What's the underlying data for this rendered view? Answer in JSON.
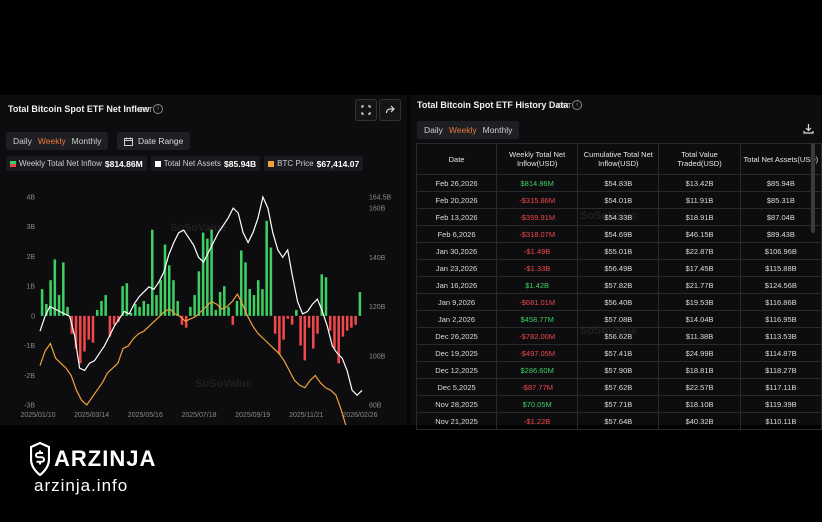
{
  "left_panel": {
    "title": "Total Bitcoin Spot ETF Net Inflow",
    "timezone": "EST",
    "tabs": [
      "Daily",
      "Weekly",
      "Monthly"
    ],
    "active_tab": "Weekly",
    "date_range_label": "Date Range",
    "legend": [
      {
        "label": "Weekly Total Net Inflow",
        "value": "$814.86M",
        "color": "#3ecf63"
      },
      {
        "label": "Total Net Assets",
        "value": "$85.94B",
        "color": "#ffffff"
      },
      {
        "label": "BTC Price",
        "value": "$67,414.07",
        "color": "#f0a33a"
      }
    ],
    "watermark": "SoSoValue"
  },
  "chart_data": {
    "type": "bar",
    "title": "Total Bitcoin Spot ETF Net Inflow",
    "x_ticks": [
      "2025/01/10",
      "2025/03/14",
      "2025/05/16",
      "2025/07/18",
      "2025/09/19",
      "2025/11/21",
      "2026/02/26"
    ],
    "y_left_ticks": [
      "4B",
      "3B",
      "2B",
      "1B",
      "0",
      "-1B",
      "-2B",
      "-3B"
    ],
    "y_left_range": [
      -3,
      4
    ],
    "y_right_ticks": [
      "164.5B",
      "160B",
      "140B",
      "120B",
      "100B",
      "80B"
    ],
    "y_right_range": [
      80,
      164.5
    ],
    "grid": false,
    "series": [
      {
        "name": "Weekly Total Net Inflow",
        "unit": "B",
        "values": [
          0.9,
          0.4,
          1.2,
          1.9,
          0.7,
          1.8,
          0.3,
          -0.6,
          -1.1,
          -1.6,
          -1.2,
          -0.8,
          -0.9,
          0.2,
          0.5,
          0.7,
          -0.7,
          -0.3,
          -0.2,
          1.0,
          1.1,
          0.1,
          0.4,
          0.3,
          0.5,
          0.4,
          2.9,
          0.7,
          1.2,
          2.4,
          1.7,
          1.2,
          0.5,
          -0.3,
          -0.4,
          0.3,
          0.7,
          1.5,
          2.8,
          2.6,
          2.9,
          0.2,
          0.8,
          1.0,
          0.3,
          -0.3,
          0.5,
          2.2,
          1.8,
          0.9,
          0.7,
          1.2,
          0.9,
          3.2,
          2.3,
          -0.6,
          -1.3,
          -0.8,
          -0.1,
          -0.3,
          0.2,
          -1.0,
          -1.5,
          -0.4,
          -1.1,
          -0.6,
          1.4,
          1.3,
          -0.5,
          -1.1,
          -1.6,
          -0.7,
          -0.5,
          -0.4,
          -0.3,
          0.8
        ]
      },
      {
        "name": "Total Net Assets",
        "unit": "B",
        "values": [
          110,
          116,
          120,
          119,
          118,
          117,
          116,
          108,
          95,
          94,
          97,
          98,
          101,
          104,
          108,
          112,
          115,
          118,
          117,
          121,
          124,
          126,
          128,
          127,
          130,
          134,
          141,
          146,
          150,
          151,
          148,
          145,
          140,
          138,
          142,
          146,
          150,
          153,
          156,
          160,
          158,
          150,
          146,
          150,
          156,
          164.5,
          160,
          150,
          143,
          140,
          143,
          132,
          122,
          117,
          118,
          121,
          123,
          118,
          112,
          104,
          101,
          99,
          94,
          86,
          84,
          85.94
        ]
      },
      {
        "name": "BTC Price",
        "unit": "K",
        "values": [
          96,
          102,
          105,
          99,
          97,
          95,
          92,
          86,
          82,
          80,
          83,
          86,
          89,
          93,
          95,
          97,
          103,
          104,
          107,
          109,
          110,
          112,
          114,
          116,
          118,
          119,
          117,
          116,
          114,
          115,
          116,
          118,
          120,
          122,
          121,
          119,
          120,
          122,
          125,
          121,
          116,
          112,
          109,
          107,
          105,
          103,
          101,
          98,
          94,
          90,
          88,
          87,
          90,
          92,
          89,
          87,
          86,
          84,
          78,
          71,
          67,
          68,
          67.4
        ]
      }
    ]
  },
  "right_panel": {
    "title": "Total Bitcoin Spot ETF History Data",
    "timezone": "EST",
    "tabs": [
      "Daily",
      "Weekly",
      "Monthly"
    ],
    "active_tab": "Weekly",
    "columns": [
      "Date",
      "Weekly Total Net Inflow(USD)",
      "Cumulative Total Net Inflow(USD)",
      "Total Value Traded(USD)",
      "Total Net Assets(USD)"
    ],
    "rows": [
      {
        "date": "Feb 26,2026",
        "inflow": "$814.86M",
        "cumulative": "$54.83B",
        "traded": "$13.42B",
        "assets": "$85.94B",
        "sign": "pos"
      },
      {
        "date": "Feb 20,2026",
        "inflow": "-$315.86M",
        "cumulative": "$54.01B",
        "traded": "$11.91B",
        "assets": "$85.31B",
        "sign": "neg"
      },
      {
        "date": "Feb 13,2026",
        "inflow": "-$359.91M",
        "cumulative": "$54.33B",
        "traded": "$18.91B",
        "assets": "$87.04B",
        "sign": "neg"
      },
      {
        "date": "Feb 6,2026",
        "inflow": "-$318.07M",
        "cumulative": "$54.69B",
        "traded": "$46.15B",
        "assets": "$89.43B",
        "sign": "neg"
      },
      {
        "date": "Jan 30,2026",
        "inflow": "-$1.49B",
        "cumulative": "$55.01B",
        "traded": "$22.87B",
        "assets": "$106.96B",
        "sign": "neg"
      },
      {
        "date": "Jan 23,2026",
        "inflow": "-$1.33B",
        "cumulative": "$56.49B",
        "traded": "$17.45B",
        "assets": "$115.88B",
        "sign": "neg"
      },
      {
        "date": "Jan 16,2026",
        "inflow": "$1.42B",
        "cumulative": "$57.82B",
        "traded": "$21.77B",
        "assets": "$124.56B",
        "sign": "pos"
      },
      {
        "date": "Jan 9,2026",
        "inflow": "-$681.01M",
        "cumulative": "$56.40B",
        "traded": "$19.53B",
        "assets": "$116.86B",
        "sign": "neg"
      },
      {
        "date": "Jan 2,2026",
        "inflow": "$458.77M",
        "cumulative": "$57.08B",
        "traded": "$14.04B",
        "assets": "$116.95B",
        "sign": "pos"
      },
      {
        "date": "Dec 26,2025",
        "inflow": "-$782.00M",
        "cumulative": "$56.62B",
        "traded": "$11.38B",
        "assets": "$113.53B",
        "sign": "neg"
      },
      {
        "date": "Dec 19,2025",
        "inflow": "-$497.05M",
        "cumulative": "$57.41B",
        "traded": "$24.99B",
        "assets": "$114.87B",
        "sign": "neg"
      },
      {
        "date": "Dec 12,2025",
        "inflow": "$286.60M",
        "cumulative": "$57.90B",
        "traded": "$18.81B",
        "assets": "$118.27B",
        "sign": "pos"
      },
      {
        "date": "Dec 5,2025",
        "inflow": "-$87.77M",
        "cumulative": "$57.62B",
        "traded": "$22.57B",
        "assets": "$117.11B",
        "sign": "neg"
      },
      {
        "date": "Nov 28,2025",
        "inflow": "$70.05M",
        "cumulative": "$57.71B",
        "traded": "$18.10B",
        "assets": "$119.39B",
        "sign": "pos"
      },
      {
        "date": "Nov 21,2025",
        "inflow": "-$1.22B",
        "cumulative": "$57.64B",
        "traded": "$40.32B",
        "assets": "$110.11B",
        "sign": "neg"
      }
    ],
    "watermark": "SoSoValue"
  },
  "branding": {
    "name": "ARZINJA",
    "url": "arzinja.info"
  }
}
